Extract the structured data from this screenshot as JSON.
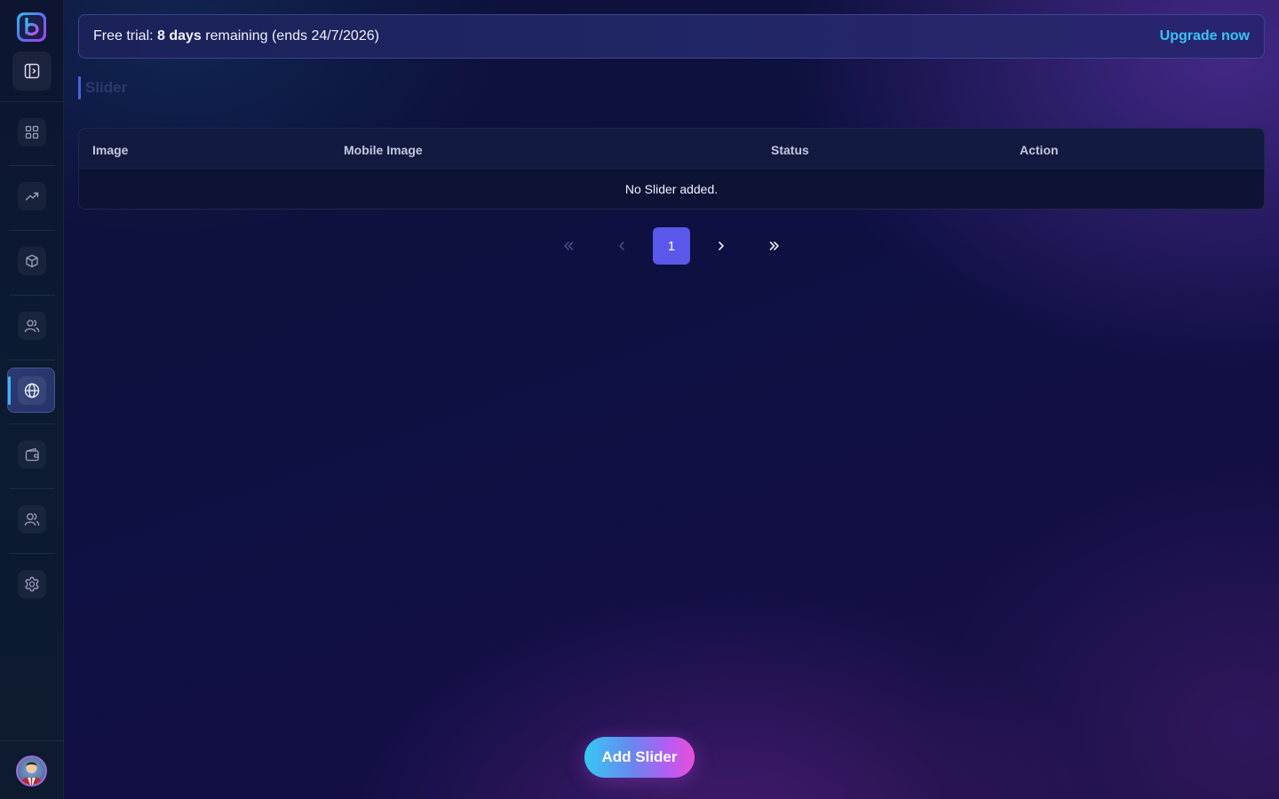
{
  "sidebar": {
    "logo_icon": "brand-logo-icon",
    "toggle_icon": "sidebar-toggle-icon",
    "items": [
      {
        "icon": "dashboard-grid-icon"
      },
      {
        "icon": "trending-up-icon"
      },
      {
        "icon": "package-box-icon"
      },
      {
        "icon": "users-icon"
      },
      {
        "icon": "globe-icon",
        "active": true
      },
      {
        "icon": "wallet-icon"
      },
      {
        "icon": "team-icon"
      },
      {
        "icon": "settings-gear-icon"
      }
    ],
    "avatar_icon": "user-avatar"
  },
  "banner": {
    "prefix": "Free trial: ",
    "days": "8 days",
    "suffix": " remaining (ends 24/7/2026)",
    "upgrade_label": "Upgrade now"
  },
  "page": {
    "title": "Slider"
  },
  "table": {
    "columns": [
      "Image",
      "Mobile Image",
      "Status",
      "Action"
    ],
    "empty_message": "No Slider added."
  },
  "pagination": {
    "first_icon": "chevrons-left-icon",
    "prev_icon": "chevron-left-icon",
    "current_page": "1",
    "next_icon": "chevron-right-icon",
    "last_icon": "chevrons-right-icon"
  },
  "actions": {
    "add_label": "Add Slider"
  },
  "colors": {
    "accent": "#5b57ea",
    "link": "#34c6f4",
    "active_bar": "#3fb6ff"
  }
}
